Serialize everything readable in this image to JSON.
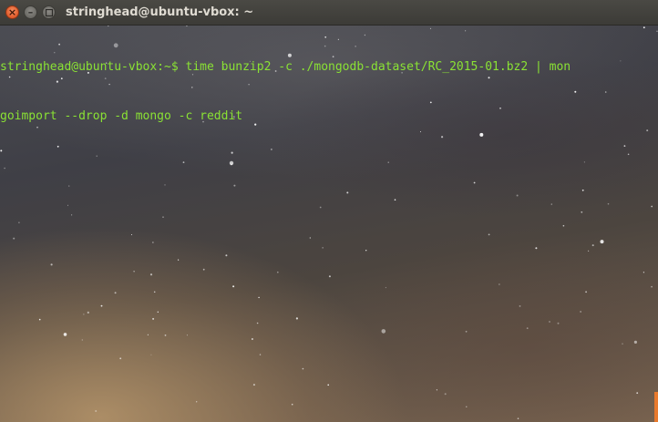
{
  "window": {
    "title": "stringhead@ubuntu-vbox: ~",
    "close_glyph": "×",
    "minimize_glyph": "–"
  },
  "terminal": {
    "lines": [
      "stringhead@ubuntu-vbox:~$ time bunzip2 -c ./mongodb-dataset/RC_2015-01.bz2 | mon",
      "goimport --drop -d mongo -c reddit"
    ]
  },
  "colors": {
    "prompt_text": "#8ae234",
    "close_button": "#e05a2a",
    "titlebar": "#3c3b37",
    "scroll_indicator": "#e87a2d"
  }
}
